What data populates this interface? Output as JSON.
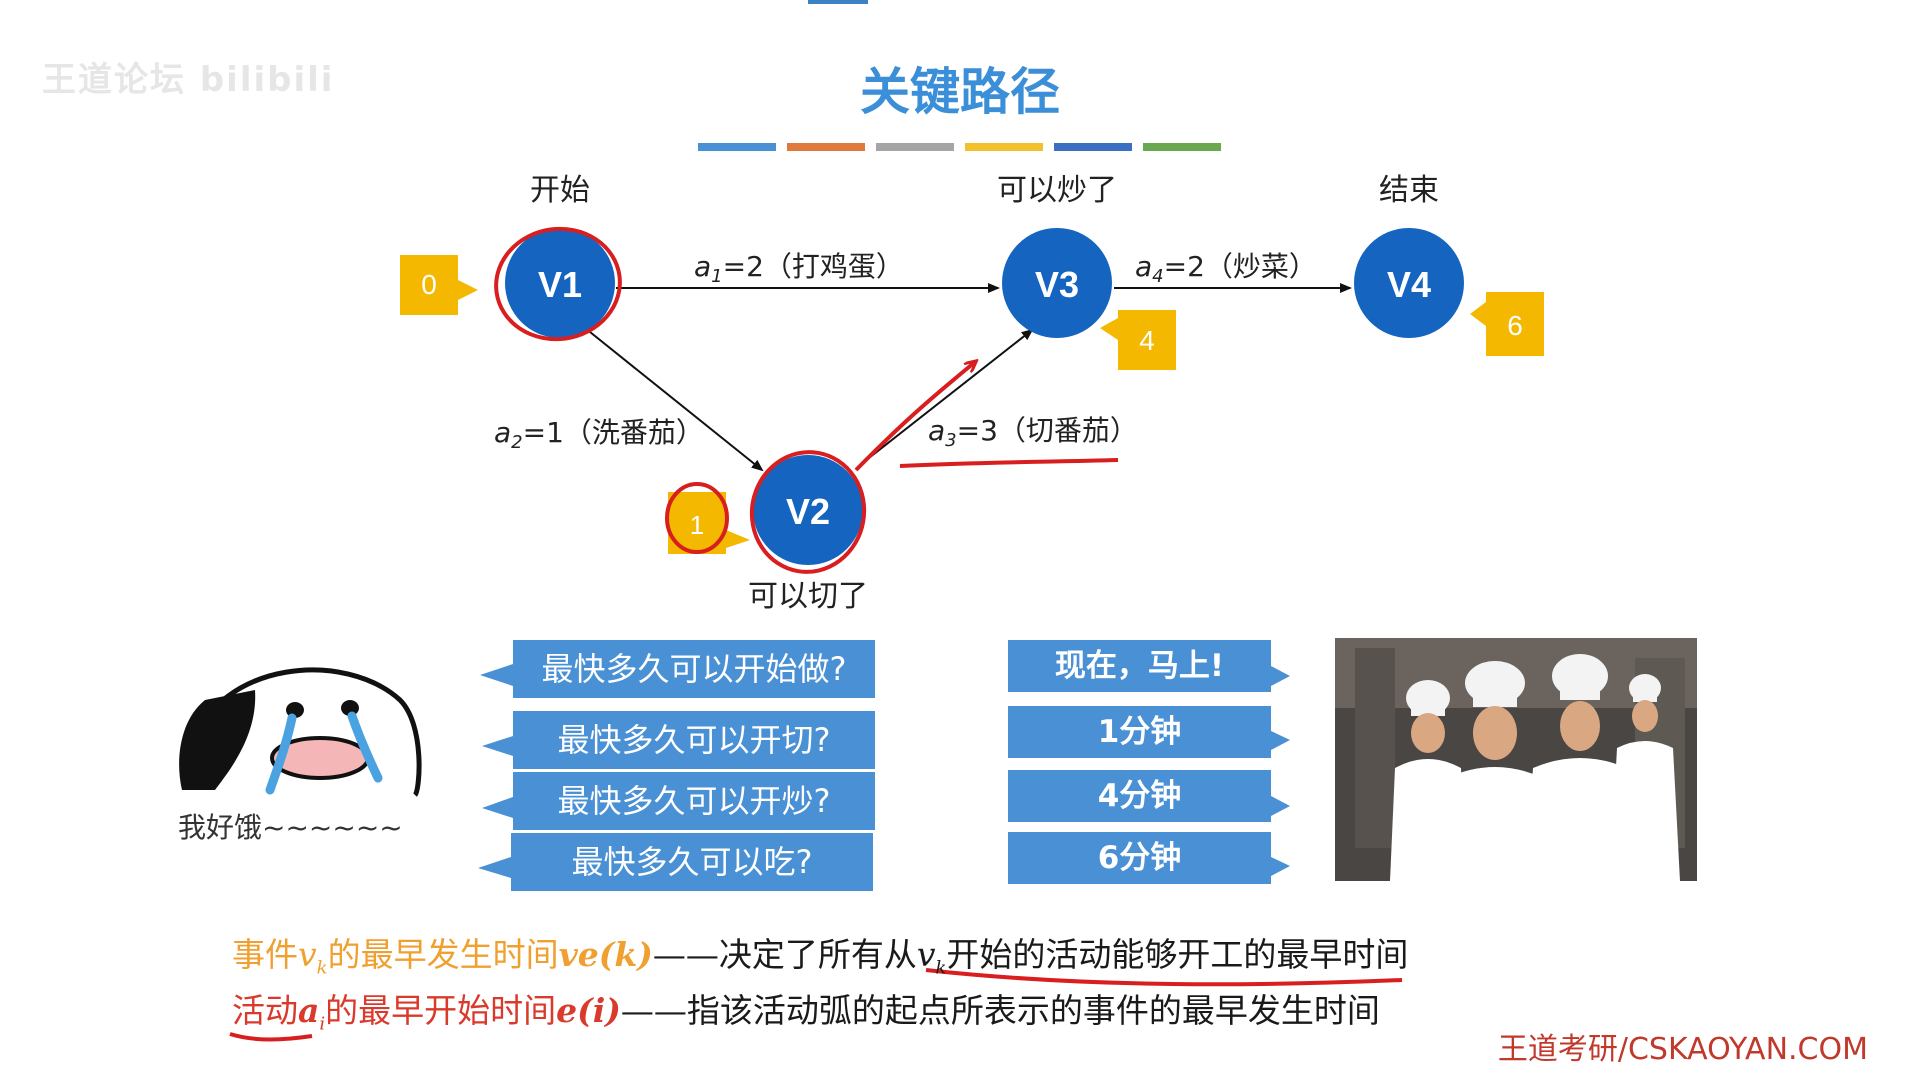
{
  "watermark": "王道论坛 bilibili",
  "title": "关键路径",
  "title_bar_colors": [
    "#4a90d4",
    "#e07a3a",
    "#a5a5a5",
    "#f2c12e",
    "#3b6fc4",
    "#6aa84f"
  ],
  "nodes": {
    "v1": {
      "label": "V1",
      "caption": "开始",
      "time": "0"
    },
    "v2": {
      "label": "V2",
      "caption": "可以切了",
      "time": "1"
    },
    "v3": {
      "label": "V3",
      "caption": "可以炒了",
      "time": "4"
    },
    "v4": {
      "label": "V4",
      "caption": "结束",
      "time": "6"
    }
  },
  "edges": {
    "a1": {
      "name": "a",
      "sub": "1",
      "rest": "=2（打鸡蛋）"
    },
    "a2": {
      "name": "a",
      "sub": "2",
      "rest": "=1（洗番茄）"
    },
    "a3": {
      "name": "a",
      "sub": "3",
      "rest": "=3（切番茄）"
    },
    "a4": {
      "name": "a",
      "sub": "4",
      "rest": "=2（炒菜）"
    }
  },
  "questions": [
    "最快多久可以开始做?",
    "最快多久可以开切?",
    "最快多久可以开炒?",
    "最快多久可以吃?"
  ],
  "answers": [
    "现在，马上!",
    "1分钟",
    "4分钟",
    "6分钟"
  ],
  "hungry_text": "我好饿~~~~~~",
  "definitions": {
    "line1": {
      "part1": "事件",
      "var": "v",
      "sub": "k",
      "part2": "的最早发生时间",
      "fn": "ve(k)",
      "dash": "——",
      "desc_pre": "决定了所有从",
      "desc_var": "v",
      "desc_sub": "k",
      "desc_post": "开始的活动能够开工的最早时间"
    },
    "line2": {
      "part1": "活动",
      "var": "a",
      "sub": "i",
      "part2": "的最早开始时间",
      "fn": "e(i)",
      "dash": "——",
      "desc": "指该活动弧的起点所表示的事件的最早发生时间"
    }
  },
  "brand": "王道考研/CSKAOYAN.COM",
  "colors": {
    "node": "#1565c0",
    "tag": "#f5b800",
    "box": "#4a90d4",
    "title": "#3b8ed8",
    "annotation": "#d81e1e",
    "orange": "#f0a030"
  }
}
